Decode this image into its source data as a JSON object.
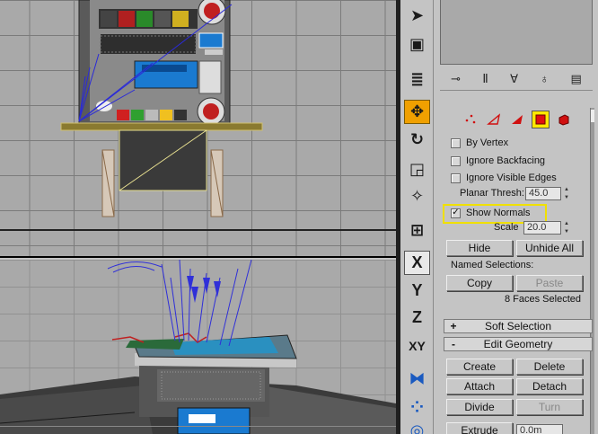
{
  "toolbar": {
    "items": [
      {
        "name": "select-arrow-icon",
        "glyph": "➤"
      },
      {
        "name": "region-select-icon",
        "glyph": "▣"
      },
      {
        "name": "select-by-name-icon",
        "glyph": "≣"
      },
      {
        "name": "move-icon",
        "glyph": "✥"
      },
      {
        "name": "rotate-icon",
        "glyph": "↻"
      },
      {
        "name": "scale-icon",
        "glyph": "◲"
      },
      {
        "name": "manipulate-icon",
        "glyph": "✧"
      },
      {
        "name": "snap-icon",
        "glyph": "⊞"
      },
      {
        "name": "axis-x-icon",
        "glyph": "X"
      },
      {
        "name": "axis-y-icon",
        "glyph": "Y"
      },
      {
        "name": "axis-z-icon",
        "glyph": "Z"
      },
      {
        "name": "axis-xy-icon",
        "glyph": "XY"
      },
      {
        "name": "mirror-icon",
        "glyph": "⧓"
      },
      {
        "name": "array-icon",
        "glyph": "⁘"
      },
      {
        "name": "align-icon",
        "glyph": "◎"
      }
    ],
    "accent": "#f0a000"
  },
  "panel": {
    "by_vertex": "By Vertex",
    "ignore_backfacing": "Ignore Backfacing",
    "ignore_visible_edges": "Ignore Visible Edges",
    "planar_thresh_label": "Planar Thresh:",
    "planar_thresh_value": "45.0",
    "show_normals": "Show Normals",
    "show_normals_checked": "✓",
    "scale_label": "Scale",
    "scale_value": "20.0",
    "hide": "Hide",
    "unhide_all": "Unhide All",
    "named_selections": "Named Selections:",
    "copy": "Copy",
    "paste": "Paste",
    "faces_selected": "8 Faces Selected",
    "soft_selection_sign": "+",
    "soft_selection": "Soft Selection",
    "edit_geometry_sign": "-",
    "edit_geometry": "Edit Geometry",
    "create": "Create",
    "delete": "Delete",
    "attach": "Attach",
    "detach": "Detach",
    "divide": "Divide",
    "turn": "Turn",
    "extrude": "Extrude",
    "extrude_value": "0.0m",
    "highlight_color": "#f0e000"
  }
}
